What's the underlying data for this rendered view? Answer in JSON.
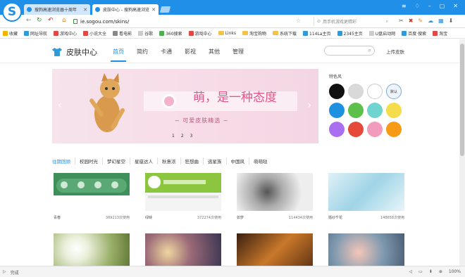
{
  "browser": {
    "logo_letter": "S",
    "tabs": [
      {
        "label": "搜狗高速浏览器十周年",
        "active": false
      },
      {
        "label": "皮肤中心 - 搜狗高速浏览",
        "active": true
      }
    ],
    "address": {
      "url": "ie.sogou.com/skins/"
    },
    "search_placeholder": "用手机游戏更精彩",
    "accent": "#1f8fe8"
  },
  "bookmarks": [
    {
      "label": "收藏",
      "icon": "star-icon",
      "color": "#f4b400"
    },
    {
      "label": "网址导航",
      "icon": "globe-icon",
      "color": "#2e9ad8"
    },
    {
      "label": "游戏中心",
      "icon": "game-icon",
      "color": "#e04848"
    },
    {
      "label": "小说大全",
      "icon": "book-icon",
      "color": "#e04848"
    },
    {
      "label": "看电影",
      "icon": "movie-icon",
      "color": "#888888"
    },
    {
      "label": "谷歌",
      "icon": "page-icon",
      "color": "#cccccc"
    },
    {
      "label": "360搜索",
      "icon": "search-icon",
      "color": "#4caf50"
    },
    {
      "label": "游戏中心",
      "icon": "game-icon",
      "color": "#e04848"
    },
    {
      "label": "Links",
      "icon": "folder-icon",
      "color": "#f4c24b"
    },
    {
      "label": "淘宝购物",
      "icon": "folder-icon",
      "color": "#f4c24b"
    },
    {
      "label": "系统下载",
      "icon": "folder-icon",
      "color": "#f4c24b"
    },
    {
      "label": "114La主页",
      "icon": "page-icon",
      "color": "#2e9ad8"
    },
    {
      "label": "2345主页",
      "icon": "page-icon",
      "color": "#2e9ad8"
    },
    {
      "label": "U盘启动网",
      "icon": "page-icon",
      "color": "#cccccc"
    },
    {
      "label": "百度·搜索",
      "icon": "page-icon",
      "color": "#2e9ad8"
    },
    {
      "label": "淘宝",
      "icon": "page-icon",
      "color": "#e04848"
    }
  ],
  "site": {
    "title": "皮肤中心",
    "nav": [
      "首页",
      "简约",
      "卡通",
      "影视",
      "其他",
      "管理"
    ],
    "active_nav": "首页",
    "upload": "上传皮肤"
  },
  "banner": {
    "headline": "萌，是一种态度",
    "subline": "~ 可爱皮肤精选 ~",
    "pages": [
      "1",
      "2",
      "3"
    ]
  },
  "colors": {
    "title": "特色风",
    "swatches": [
      {
        "color": "#111111",
        "label": ""
      },
      {
        "color": "#d9d9d9",
        "label": ""
      },
      {
        "color": "#ffffff",
        "label": ""
      },
      {
        "color": "#eef4fb",
        "label": "默认"
      },
      {
        "color": "#1e90e0",
        "label": ""
      },
      {
        "color": "#5cc04a",
        "label": ""
      },
      {
        "color": "#6fd3cf",
        "label": ""
      },
      {
        "color": "#f5dc4a",
        "label": ""
      },
      {
        "color": "#a96ff0",
        "label": ""
      },
      {
        "color": "#e5493a",
        "label": ""
      },
      {
        "color": "#f29bbd",
        "label": ""
      },
      {
        "color": "#f79a16",
        "label": ""
      }
    ]
  },
  "categories": [
    "往期回顾",
    "校园时光",
    "梦幻星空",
    "星座达人",
    "秋意浓",
    "狂想曲",
    "逃星族",
    "中国风",
    "萌萌哒"
  ],
  "skins": [
    {
      "name": "青春",
      "count": "369213次使用"
    },
    {
      "name": "绿映",
      "count": "372274次使用"
    },
    {
      "name": "如梦",
      "count": "114434次使用"
    },
    {
      "name": "婚纱千花",
      "count": "148658次使用"
    }
  ],
  "status": {
    "left": "完成",
    "zoom": "100%"
  }
}
